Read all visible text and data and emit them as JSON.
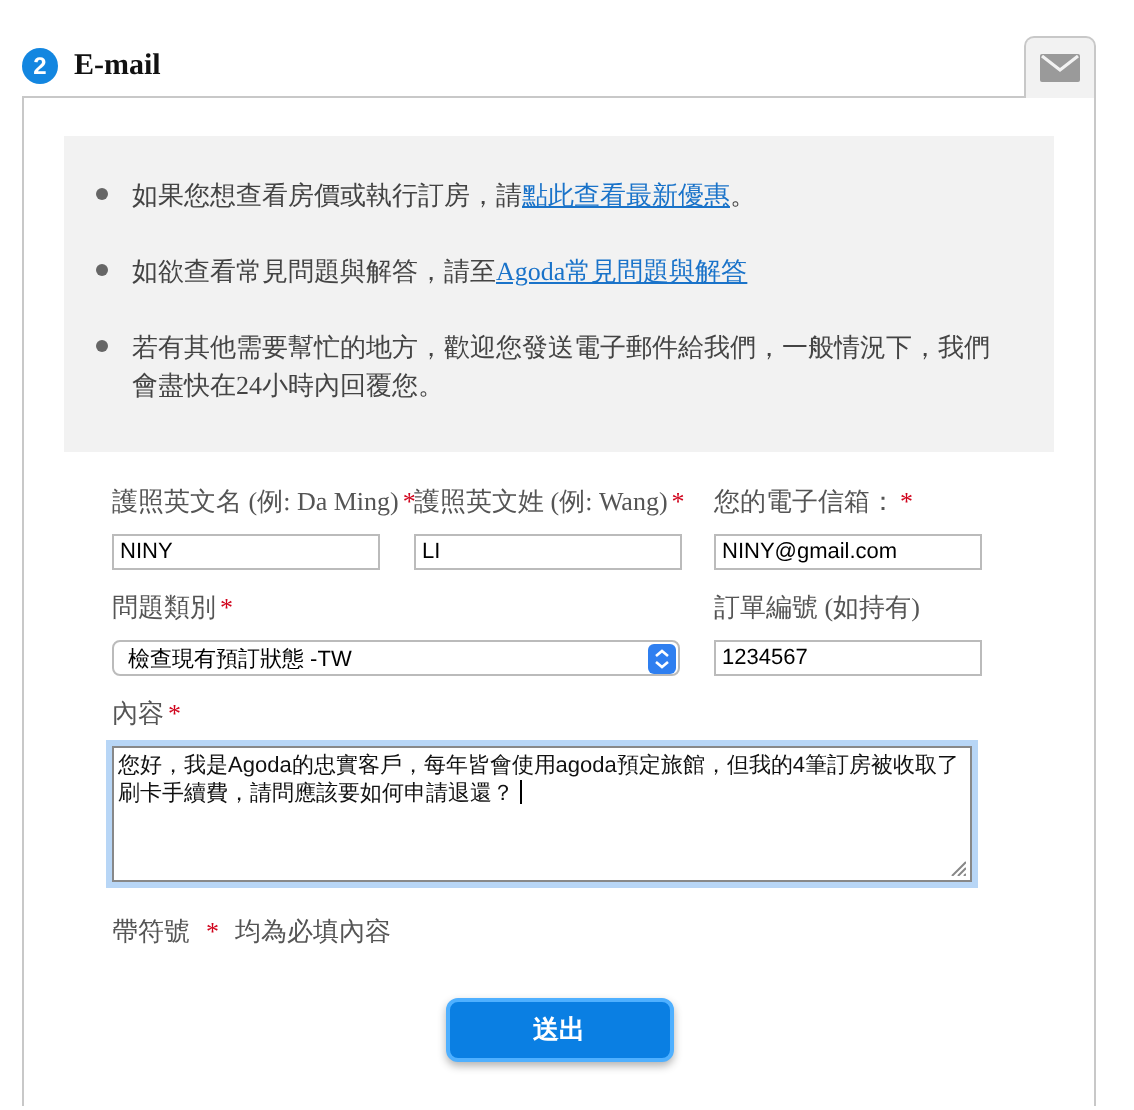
{
  "section": {
    "step": "2",
    "title": "E-mail"
  },
  "info_items": [
    {
      "text": "如果您想查看房價或執行訂房，請",
      "link": "點此查看最新優惠",
      "after": "。"
    },
    {
      "text": "如欲查看常見問題與解答，請至",
      "link": "Agoda常見問題與解答"
    },
    {
      "text": "若有其他需要幫忙的地方，歡迎您發送電子郵件給我們，一般情況下，我們會盡快在24小時內回覆您。"
    }
  ],
  "fields": [
    {
      "kind": "text",
      "label": "護照英文名 (例: Da Ming)",
      "required_mark": "*",
      "value": "NINY"
    },
    {
      "kind": "text",
      "label": "護照英文姓 (例: Wang)",
      "required_mark": "*",
      "value": "LI"
    },
    {
      "kind": "text",
      "label": "您的電子信箱：",
      "required_mark": "*",
      "value": "NINY@gmail.com"
    },
    {
      "kind": "select",
      "label": "問題類別",
      "required_mark": "*",
      "value": "檢查現有預訂狀態 -TW"
    },
    {
      "kind": "text",
      "label": "訂單編號 (如持有)",
      "value": "1234567"
    },
    {
      "kind": "textarea",
      "label": "內容",
      "required_mark": "*",
      "value": "您好，我是Agoda的忠實客戶，每年皆會使用agoda預定旅館，但我的4筆訂房被收取了刷卡手續費，請問應該要如何申請退還？",
      "focused": true
    }
  ],
  "required_note": {
    "before": "帶符號",
    "mark": "*",
    "after": "均為必填內容"
  },
  "submit_button": "送出"
}
